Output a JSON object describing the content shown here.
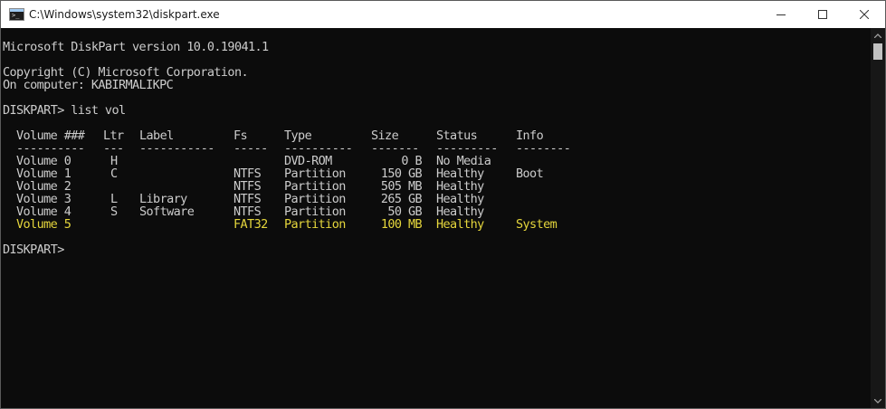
{
  "window": {
    "title": "C:\\Windows\\system32\\diskpart.exe",
    "icon": "cmd-icon",
    "controls": [
      "minimize-icon",
      "maximize-icon",
      "close-icon"
    ]
  },
  "terminal": {
    "header_lines": [
      "Microsoft DiskPart version 10.0.19041.1",
      "Copyright (C) Microsoft Corporation.",
      "On computer: KABIRMALIKPC",
      "DISKPART> list vol"
    ],
    "columns": [
      "Volume ###",
      "Ltr",
      "Label",
      "Fs",
      "Type",
      "Size",
      "Status",
      "Info"
    ],
    "separators": [
      "----------",
      "---",
      "-----------",
      "-----",
      "----------",
      "-------",
      "---------",
      "--------"
    ],
    "rows": [
      {
        "vol": "Volume 0",
        "ltr": "H",
        "label": "",
        "fs": "",
        "type": "DVD-ROM",
        "size": "0 B",
        "status": "No Media",
        "info": ""
      },
      {
        "vol": "Volume 1",
        "ltr": "C",
        "label": "",
        "fs": "NTFS",
        "type": "Partition",
        "size": "150 GB",
        "status": "Healthy",
        "info": "Boot"
      },
      {
        "vol": "Volume 2",
        "ltr": "",
        "label": "",
        "fs": "NTFS",
        "type": "Partition",
        "size": "505 MB",
        "status": "Healthy",
        "info": ""
      },
      {
        "vol": "Volume 3",
        "ltr": "L",
        "label": "Library",
        "fs": "NTFS",
        "type": "Partition",
        "size": "265 GB",
        "status": "Healthy",
        "info": ""
      },
      {
        "vol": "Volume 4",
        "ltr": "S",
        "label": "Software",
        "fs": "NTFS",
        "type": "Partition",
        "size": "50 GB",
        "status": "Healthy",
        "info": ""
      },
      {
        "vol": "Volume 5",
        "ltr": "",
        "label": "",
        "fs": "FAT32",
        "type": "Partition",
        "size": "100 MB",
        "status": "Healthy",
        "info": "System"
      }
    ],
    "highlighted_row": 5,
    "prompt": "DISKPART>"
  },
  "colors": {
    "background": "#0c0c0c",
    "text": "#cccccc",
    "highlight": "#e5d63c",
    "titlebar": "#ffffff"
  }
}
